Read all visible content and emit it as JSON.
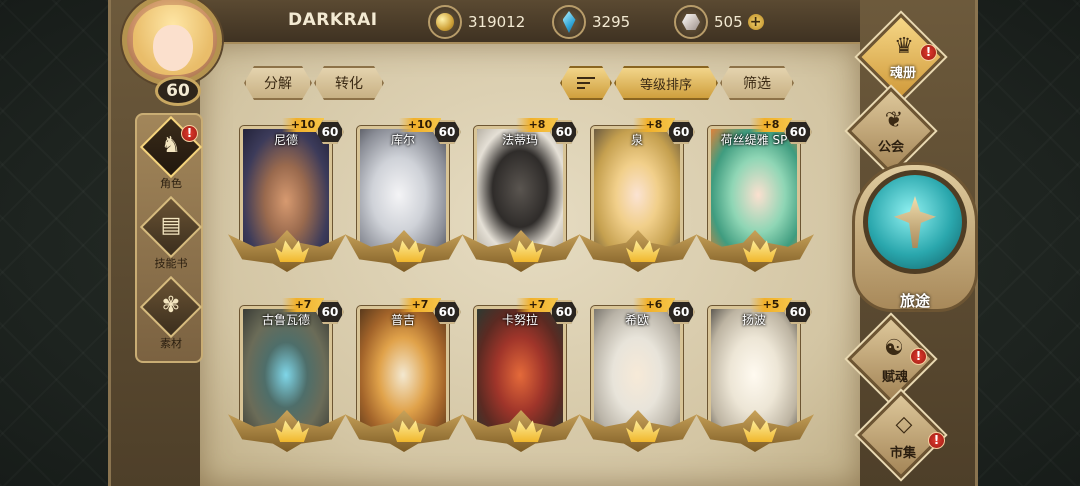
{
  "player": {
    "name": "DARKRAI",
    "level": "60"
  },
  "currencies": [
    {
      "icon": "gold-coin-icon",
      "value": "319012"
    },
    {
      "icon": "blue-gem-icon",
      "value": "3295"
    },
    {
      "icon": "crystal-icon",
      "value": "505",
      "add": "+"
    }
  ],
  "alert_mark": "!",
  "left_menu": [
    {
      "label": "角色",
      "icon": "character-icon"
    },
    {
      "label": "技能书",
      "icon": "skill-book-icon"
    },
    {
      "label": "素材",
      "icon": "material-icon"
    }
  ],
  "actions": {
    "decompose": "分解",
    "convert": "转化",
    "sort_by_level": "等级排序",
    "filter": "筛选"
  },
  "heroes": [
    {
      "name": "尼德",
      "plus": "+10",
      "level": "60"
    },
    {
      "name": "库尔",
      "plus": "+10",
      "level": "60"
    },
    {
      "name": "法蒂玛",
      "plus": "+8",
      "level": "60"
    },
    {
      "name": "泉",
      "plus": "+8",
      "level": "60"
    },
    {
      "name": "荷丝缇雅 SP",
      "plus": "+8",
      "level": "60"
    },
    {
      "name": "古鲁瓦德",
      "plus": "+7",
      "level": "60"
    },
    {
      "name": "普吉",
      "plus": "+7",
      "level": "60"
    },
    {
      "name": "卡努拉",
      "plus": "+7",
      "level": "60"
    },
    {
      "name": "希欧",
      "plus": "+6",
      "level": "60"
    },
    {
      "name": "扬波",
      "plus": "+5",
      "level": "60"
    }
  ],
  "right_nav": {
    "soul_book": "魂册",
    "guild": "公会",
    "journey": "旅途",
    "bestow_soul": "赋魂",
    "market": "市集"
  },
  "colors": {
    "parchment": "#d9cca9",
    "gold_accent": "#f1b02a",
    "alert_red": "#e23b2f",
    "orb_teal": "#2aa7ad"
  }
}
